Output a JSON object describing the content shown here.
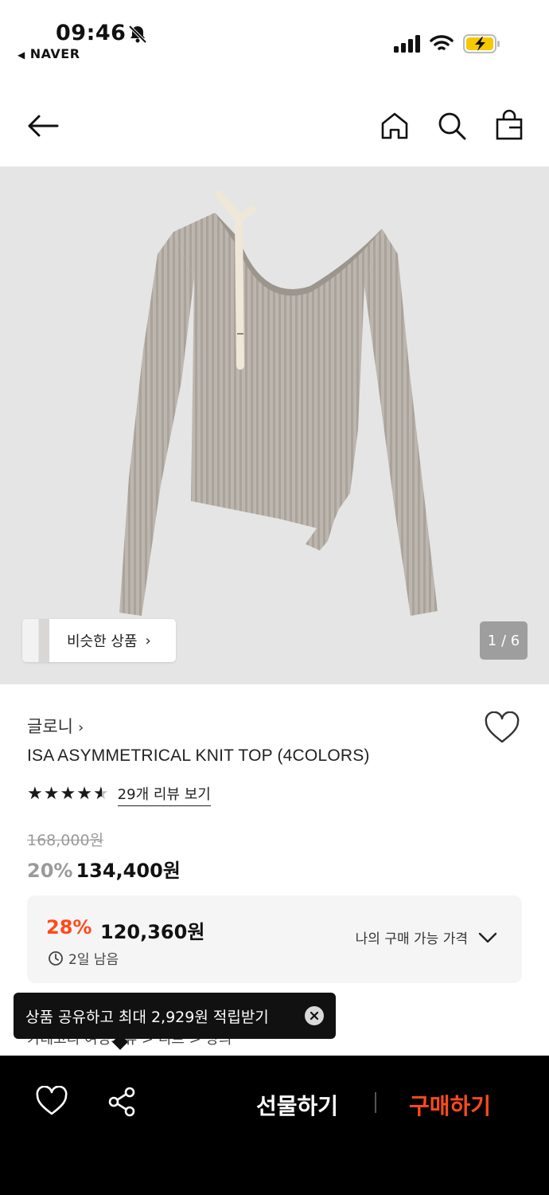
{
  "status_bar": {
    "time": "09:46",
    "back_app": "NAVER",
    "icons": [
      "bell-slash-icon",
      "signal-icon",
      "wifi-icon",
      "battery-charging-icon"
    ]
  },
  "nav": {
    "icons": [
      "arrow-left-icon",
      "home-icon",
      "search-icon",
      "bag-icon"
    ]
  },
  "hero": {
    "similar_label": "비슷한 상품",
    "page_indicator": "1 / 6"
  },
  "product": {
    "brand": "글로니",
    "title": "ISA ASYMMETRICAL KNIT TOP (4COLORS)",
    "rating": 4.5,
    "review_link": "29개 리뷰 보기",
    "original_price": "168,000원",
    "discount_pct": "20%",
    "sale_price": "134,400원"
  },
  "coupon": {
    "pct": "28%",
    "price": "120,360원",
    "timer": "2일 남음",
    "action_label": "나의 구매 가능 가격"
  },
  "breadcrumbs": {
    "text": "카테고리    여성의류 > 니트 > 상의"
  },
  "toast": {
    "text": "상품 공유하고 최대 2,929원 적립받기"
  },
  "bottom_bar": {
    "gift_label": "선물하기",
    "buy_label": "구매하기"
  },
  "colors": {
    "accent": "#ff4a1c",
    "hero_bg": "#e6e5e5",
    "bar_bg": "#000000"
  }
}
